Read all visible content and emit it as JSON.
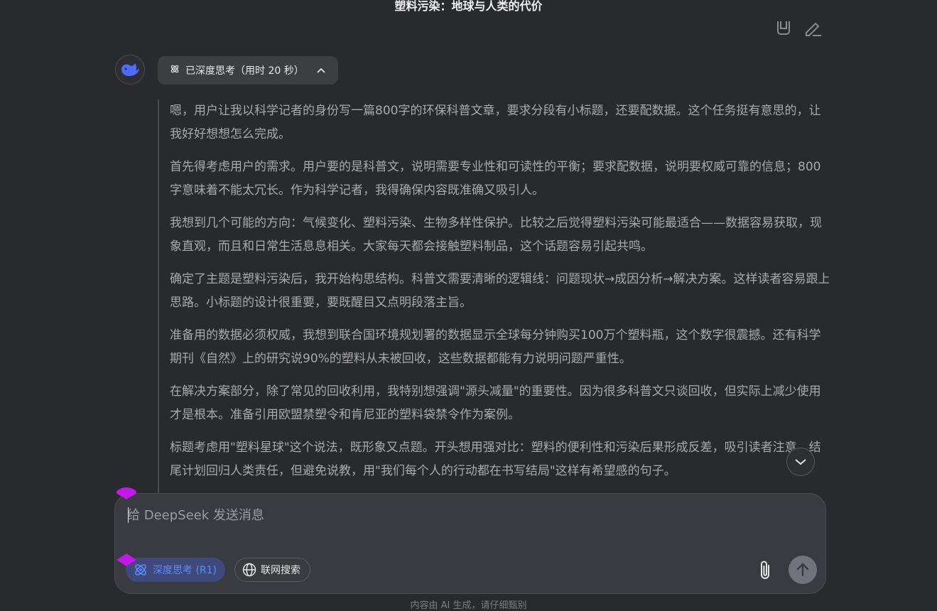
{
  "header": {
    "title": "塑料污染：地球与人类的代价"
  },
  "icons": {
    "copy": "copy-icon",
    "edit": "edit-icon",
    "avatar": "deepseek-whale-logo",
    "thinking": "atom-icon",
    "chevron": "chevron-up-icon",
    "scroll": "chevron-down-icon",
    "globe": "globe-icon",
    "attach": "paperclip-icon",
    "send": "arrow-up-icon"
  },
  "thinking": {
    "toggle_label": "已深度思考（用时 20 秒）",
    "paragraphs": [
      "嗯，用户让我以科学记者的身份写一篇800字的环保科普文章，要求分段有小标题，还要配数据。这个任务挺有意思的，让我好好想想怎么完成。",
      "首先得考虑用户的需求。用户要的是科普文，说明需要专业性和可读性的平衡；要求配数据，说明要权威可靠的信息；800字意味着不能太冗长。作为科学记者，我得确保内容既准确又吸引人。",
      "我想到几个可能的方向：气候变化、塑料污染、生物多样性保护。比较之后觉得塑料污染可能最适合——数据容易获取，现象直观，而且和日常生活息息相关。大家每天都会接触塑料制品，这个话题容易引起共鸣。",
      "确定了主题是塑料污染后，我开始构思结构。科普文需要清晰的逻辑线：问题现状→成因分析→解决方案。这样读者容易跟上思路。小标题的设计很重要，要既醒目又点明段落主旨。",
      "准备用的数据必须权威，我想到联合国环境规划署的数据显示全球每分钟购买100万个塑料瓶，这个数字很震撼。还有科学期刊《自然》上的研究说90%的塑料从未被回收，这些数据都能有力说明问题严重性。",
      "在解决方案部分，除了常见的回收利用，我特别想强调\"源头减量\"的重要性。因为很多科普文只谈回收，但实际上减少使用才是根本。准备引用欧盟禁塑令和肯尼亚的塑料袋禁令作为案例。",
      "标题考虑用\"塑料星球\"这个说法，既形象又点题。开头想用强对比：塑料的便利性和污染后果形成反差，吸引读者注意。结尾计划回归人类责任，但避免说教，用\"我们每个人的行动都在书写结局\"这样有希望感的句子。"
    ]
  },
  "composer": {
    "placeholder": "给 DeepSeek 发送消息",
    "deep_think_label": "深度思考 (R1)",
    "web_search_label": "联网搜索"
  },
  "footer": {
    "disclaimer": "内容由 AI 生成，请仔细甄别"
  },
  "colors": {
    "accent": "#5b8cff",
    "background": "#292a2d",
    "input_bg": "#3a3b40",
    "marker": "#c218e8"
  }
}
